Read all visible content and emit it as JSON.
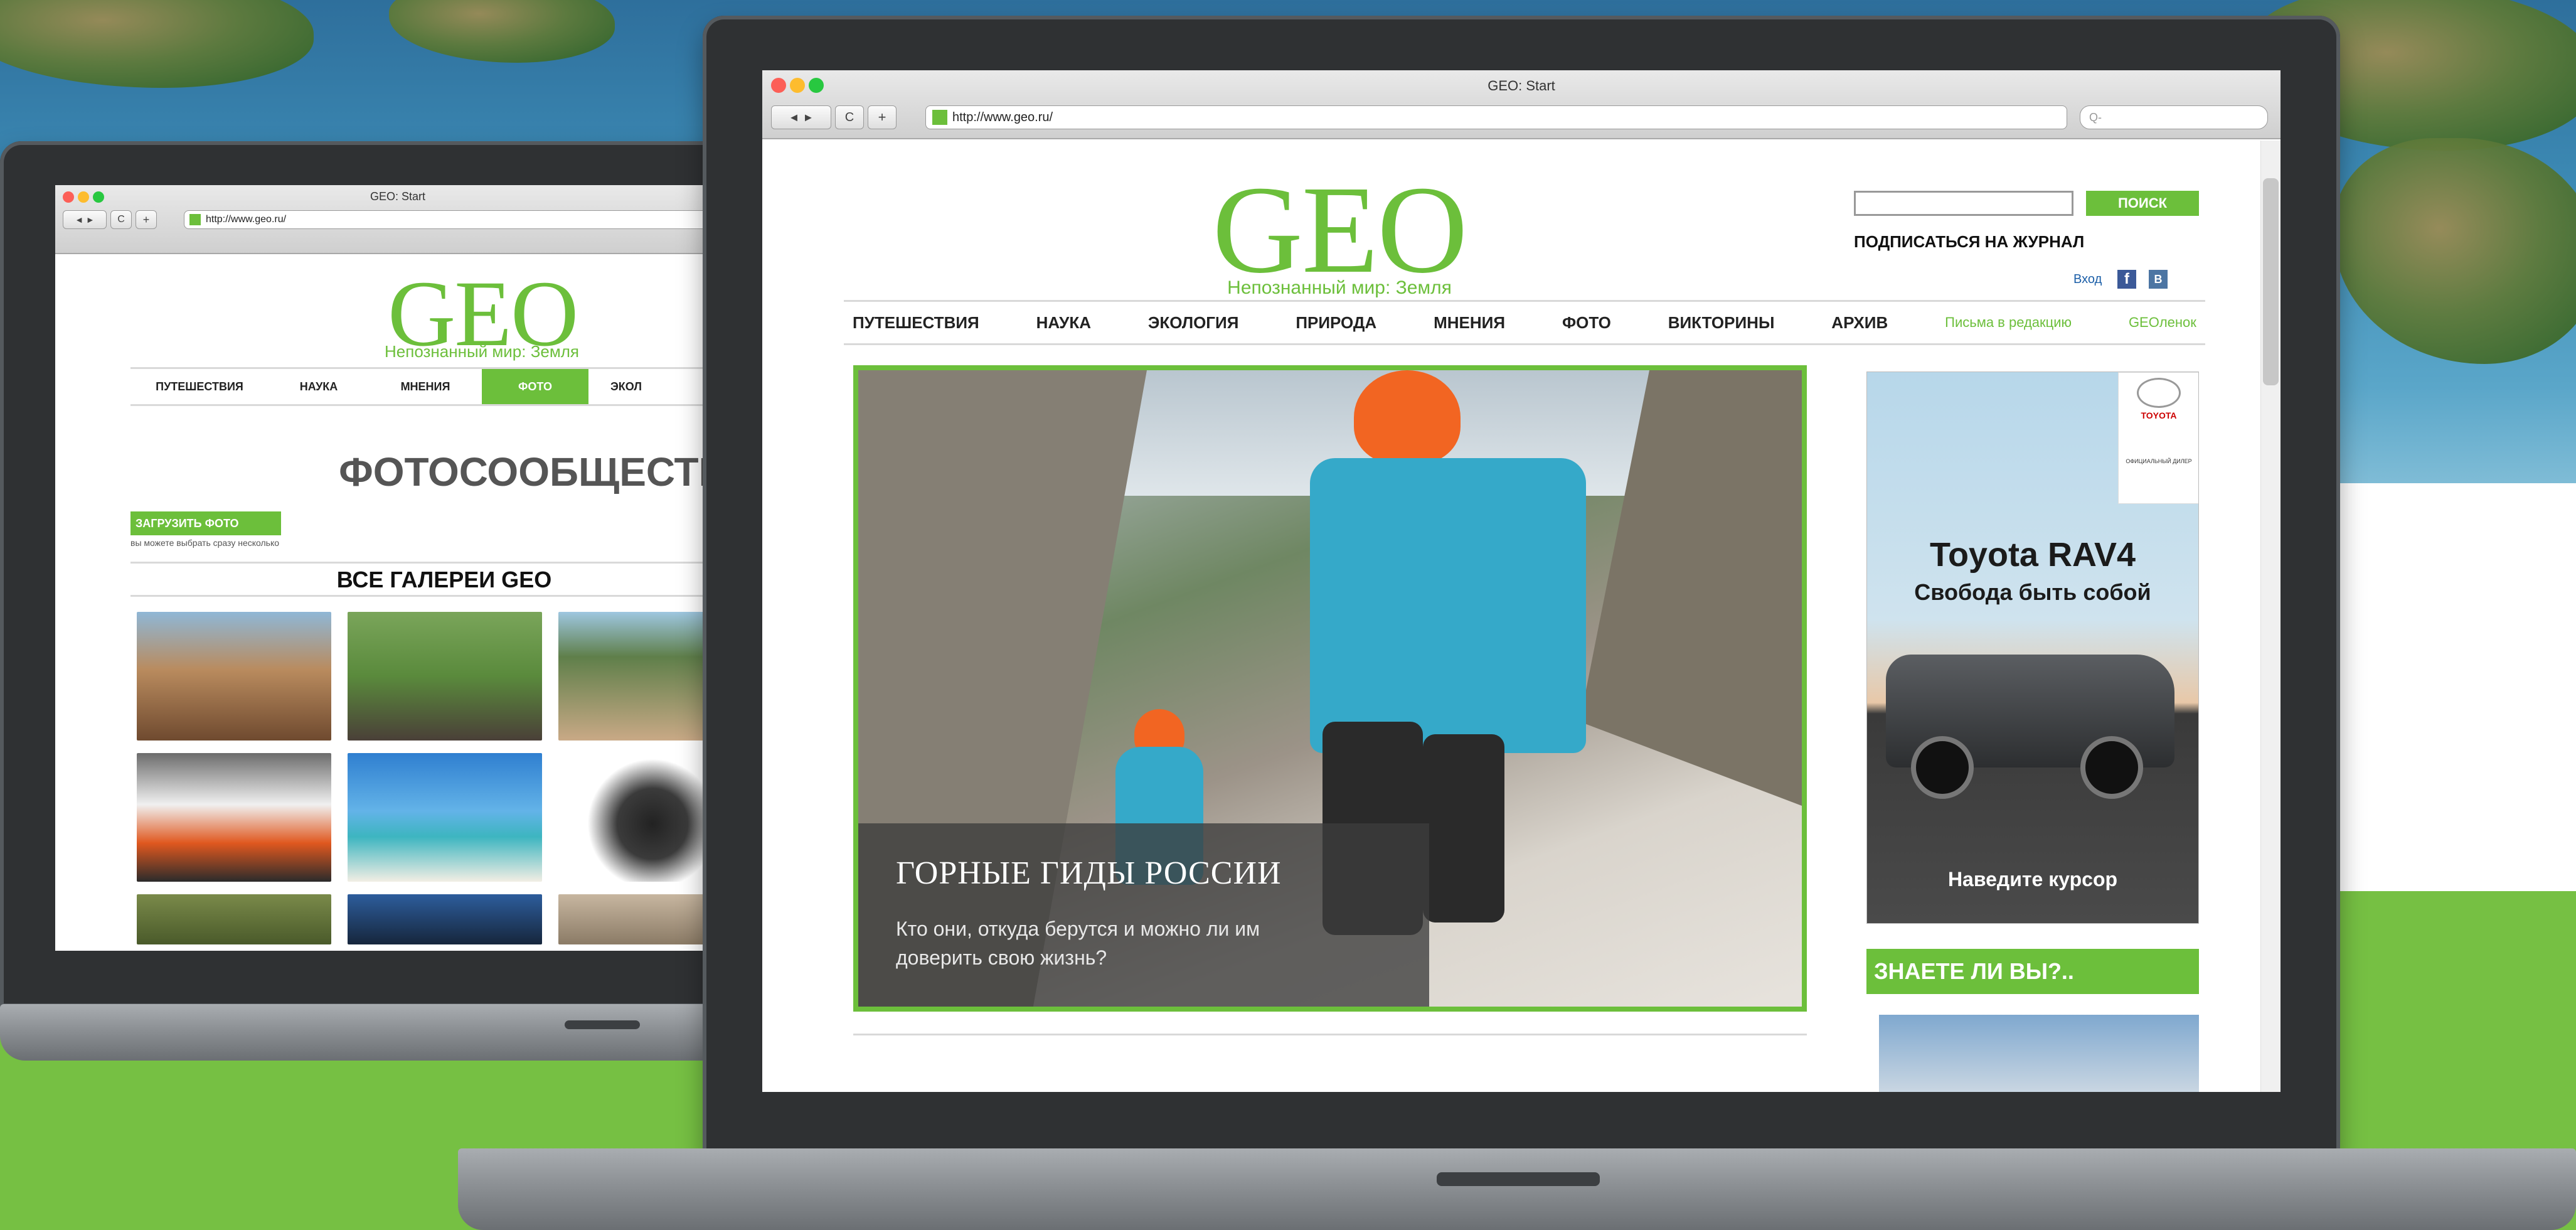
{
  "colors": {
    "geo_green": "#6cbf3b",
    "page_green": "#76c043",
    "bezel": "#2f3133"
  },
  "browser": {
    "title": "GEO: Start",
    "url": "http://www.geo.ru/",
    "search_placeholder": "Q-",
    "nav_back": "◄ ►",
    "nav_reload": "C",
    "nav_add": "+"
  },
  "front_page": {
    "logo": "GEO",
    "tagline": "Непознанный мир: Земля",
    "search_button": "ПОИСК",
    "subscribe": "ПОДПИСАТЬСЯ НА ЖУРНАЛ",
    "social_label": "Вход",
    "social_icons": [
      "facebook-icon",
      "vk-icon"
    ],
    "nav": [
      "ПУТЕШЕСТВИЯ",
      "НАУКА",
      "ЭКОЛОГИЯ",
      "ПРИРОДА",
      "МНЕНИЯ",
      "ФОТО",
      "ВИКТОРИНЫ",
      "АРХИВ",
      "Письма в редакцию",
      "GEOленок"
    ],
    "hero": {
      "headline": "ГОРНЫЕ ГИДЫ РОССИИ",
      "subtitle": "Кто они, откуда берутся и можно ли им доверить свою жизнь?"
    },
    "ad": {
      "brand": "TOYOTA",
      "brand_small": "ОФИЦИАЛЬНЫЙ ДИЛЕР",
      "title": "Toyota RAV4",
      "slogan": "Свобода быть собой",
      "cta": "Наведите курсор"
    },
    "did_you_know": "ЗНАЕТЕ ЛИ ВЫ?.."
  },
  "back_page": {
    "logo": "GEO",
    "tagline": "Непознанный мир: Земля",
    "nav": [
      "ПУТЕШЕСТВИЯ",
      "НАУКА",
      "МНЕНИЯ",
      "ФОТО",
      "ЭКОЛ"
    ],
    "active_nav": "ФОТО",
    "heading": "ФОТОСООБЩЕСТВО",
    "upload_button": "ЗАГРУЗИТЬ ФОТО",
    "upload_hint": "вы можете выбрать сразу несколько",
    "galleries_heading": "ВСЕ ГАЛЕРЕИ GEO"
  }
}
